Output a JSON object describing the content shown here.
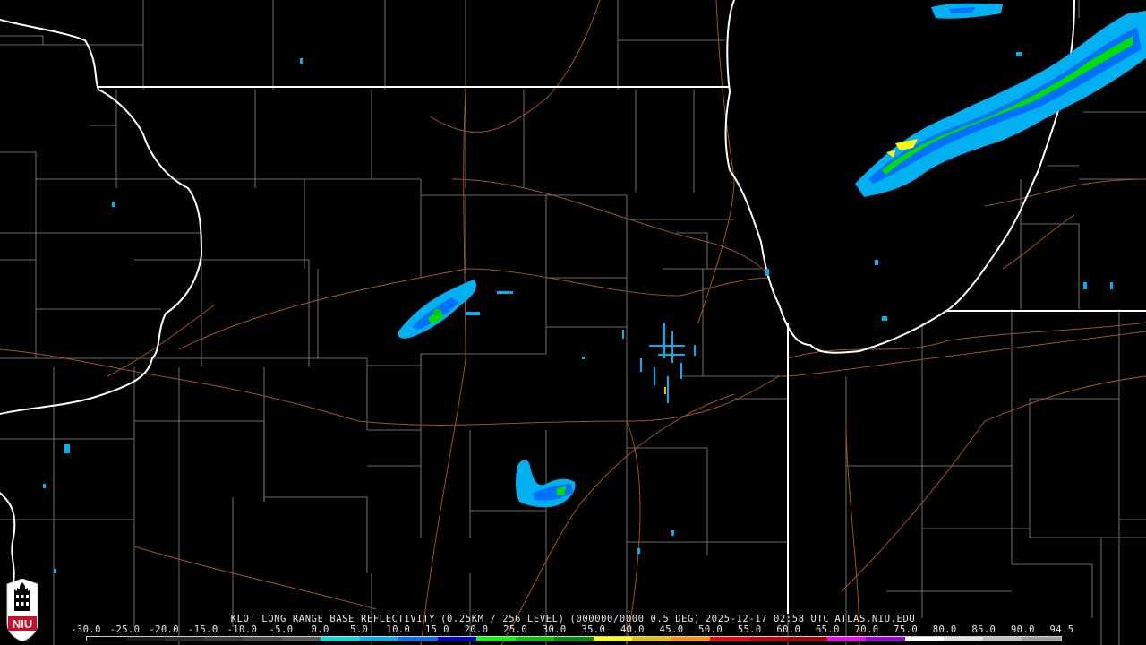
{
  "header": {
    "product": "KLOT LONG RANGE BASE REFLECTIVITY",
    "resolution": "(0.25KM / 256 LEVEL)",
    "volume": "(000000/0000 0.5 DEG)",
    "timestamp": "2025-12-17 02:58 UTC",
    "source": "ATLAS.NIU.EDU"
  },
  "scale": {
    "labels": [
      "-30.0",
      "-25.0",
      "-20.0",
      "-15.0",
      "-10.0",
      "-5.0",
      "0.0",
      "5.0",
      "10.0",
      "15.0",
      "20.0",
      "25.0",
      "30.0",
      "35.0",
      "40.0",
      "45.0",
      "50.0",
      "55.0",
      "60.0",
      "65.0",
      "70.0",
      "75.0",
      "80.0",
      "85.0",
      "90.0",
      "94.5"
    ],
    "colors": [
      "#000000",
      "#1a1a1a",
      "#2a2a2a",
      "#3a3a3a",
      "#4a4a4a",
      "#5a5a5a",
      "#00e0e0",
      "#00b0f0",
      "#0070ff",
      "#0000e0",
      "#00ff00",
      "#00c800",
      "#009000",
      "#ffff00",
      "#e8c000",
      "#ff9000",
      "#ff0000",
      "#d00000",
      "#b00000",
      "#ff00ff",
      "#a000e0",
      "#ffffff",
      "#e0e0e0",
      "#c0c0c0",
      "#a0a0a0"
    ]
  },
  "logo": {
    "text": "NIU",
    "color": "#c8102e"
  },
  "colors": {
    "state_line": "#ffffff",
    "county_line": "#8c8c8c",
    "highway": "#a0522d",
    "background": "#000000"
  }
}
